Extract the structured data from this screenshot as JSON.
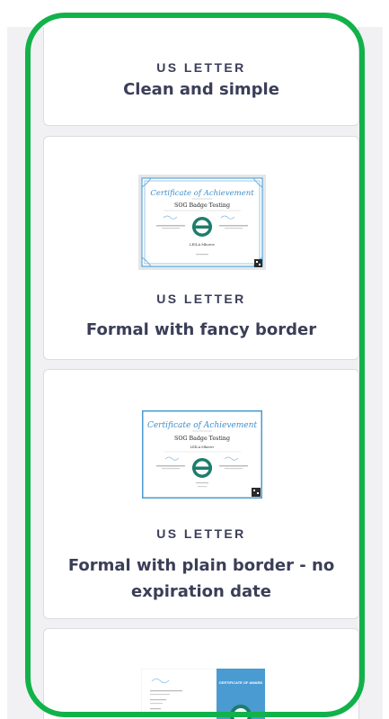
{
  "templates": [
    {
      "paper_size": "US LETTER",
      "name": "Clean and simple"
    },
    {
      "paper_size": "US LETTER",
      "name": "Formal with fancy border",
      "preview": {
        "heading": "Certificate of Achievement",
        "badge": "SOG Badge Testing",
        "recipient": "LEILA Mkorov"
      }
    },
    {
      "paper_size": "US LETTER",
      "name": "Formal with plain border - no expiration date",
      "preview": {
        "heading": "Certificate of Achievement",
        "badge": "SOG Badge Testing",
        "recipient": "LEILA Mkorov"
      }
    },
    {
      "paper_size": "US LETTER",
      "name": "",
      "preview": {
        "heading": "CERTIFICATE OF AWARD"
      }
    }
  ],
  "colors": {
    "accent_blue": "#4a9bd1",
    "badge_teal": "#1d7d6c",
    "highlight_green": "#12b24a"
  }
}
